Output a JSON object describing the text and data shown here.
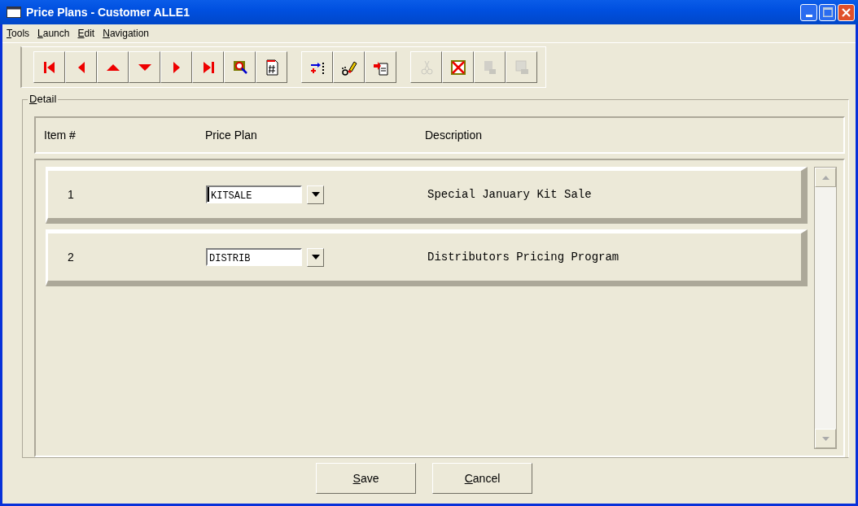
{
  "window": {
    "title": "Price Plans - Customer ALLE1"
  },
  "menu": [
    {
      "label": "Tools"
    },
    {
      "label": "Launch"
    },
    {
      "label": "Edit"
    },
    {
      "label": "Navigation"
    }
  ],
  "toolbar": [
    [
      {
        "kind": "first",
        "disabled": false
      },
      {
        "kind": "prev",
        "disabled": false
      },
      {
        "kind": "up",
        "disabled": false
      },
      {
        "kind": "down",
        "disabled": false
      },
      {
        "kind": "next",
        "disabled": false
      },
      {
        "kind": "last",
        "disabled": false
      },
      {
        "kind": "find",
        "disabled": false
      },
      {
        "kind": "number",
        "disabled": false
      }
    ],
    [
      {
        "kind": "insert",
        "disabled": false
      },
      {
        "kind": "erase",
        "disabled": false
      },
      {
        "kind": "import",
        "disabled": false
      }
    ],
    [
      {
        "kind": "cut",
        "disabled": true
      },
      {
        "kind": "delete",
        "disabled": false
      },
      {
        "kind": "copy",
        "disabled": true
      },
      {
        "kind": "paste",
        "disabled": true
      }
    ]
  ],
  "detail": {
    "label": "Detail",
    "columns": [
      "Item #",
      "Price Plan",
      "Description"
    ],
    "rows": [
      {
        "item": "1",
        "price_plan": "KITSALE",
        "description": "Special January Kit Sale",
        "focused": true
      },
      {
        "item": "2",
        "price_plan": "DISTRIB",
        "description": "Distributors Pricing Program",
        "focused": false
      }
    ]
  },
  "buttons": [
    {
      "label": "Save"
    },
    {
      "label": "Cancel"
    }
  ]
}
